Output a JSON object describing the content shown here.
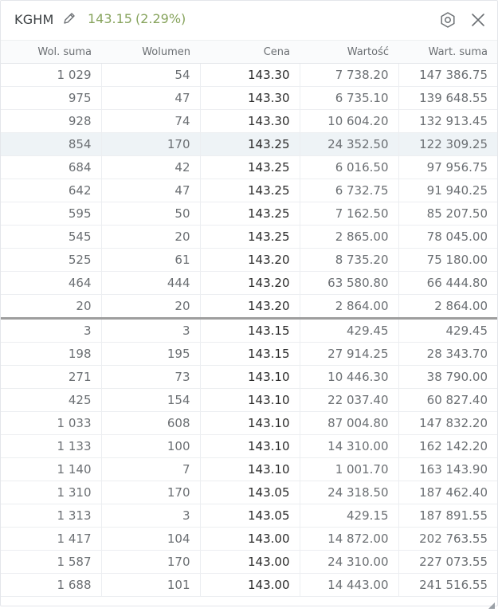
{
  "header": {
    "ticker": "KGHM",
    "last_price": "143.15",
    "change": "(2.29%)",
    "icons": {
      "edit": "pencil-icon",
      "settings": "gear-icon",
      "close": "close-icon",
      "resize": "resize-grip-icon"
    },
    "colors": {
      "price": "#86a35c"
    }
  },
  "table": {
    "columns": [
      "Wol. suma",
      "Wolumen",
      "Cena",
      "Wartość",
      "Wart. suma"
    ],
    "sell_rows": [
      [
        "1 029",
        "54",
        "143.30",
        "7 738.20",
        "147 386.75"
      ],
      [
        "975",
        "47",
        "143.30",
        "6 735.10",
        "139 648.55"
      ],
      [
        "928",
        "74",
        "143.30",
        "10 604.20",
        "132 913.45"
      ],
      [
        "854",
        "170",
        "143.25",
        "24 352.50",
        "122 309.25"
      ],
      [
        "684",
        "42",
        "143.25",
        "6 016.50",
        "97 956.75"
      ],
      [
        "642",
        "47",
        "143.25",
        "6 732.75",
        "91 940.25"
      ],
      [
        "595",
        "50",
        "143.25",
        "7 162.50",
        "85 207.50"
      ],
      [
        "545",
        "20",
        "143.25",
        "2 865.00",
        "78 045.00"
      ],
      [
        "525",
        "61",
        "143.20",
        "8 735.20",
        "75 180.00"
      ],
      [
        "464",
        "444",
        "143.20",
        "63 580.80",
        "66 444.80"
      ],
      [
        "20",
        "20",
        "143.20",
        "2 864.00",
        "2 864.00"
      ]
    ],
    "buy_rows": [
      [
        "3",
        "3",
        "143.15",
        "429.45",
        "429.45"
      ],
      [
        "198",
        "195",
        "143.15",
        "27 914.25",
        "28 343.70"
      ],
      [
        "271",
        "73",
        "143.10",
        "10 446.30",
        "38 790.00"
      ],
      [
        "425",
        "154",
        "143.10",
        "22 037.40",
        "60 827.40"
      ],
      [
        "1 033",
        "608",
        "143.10",
        "87 004.80",
        "147 832.20"
      ],
      [
        "1 133",
        "100",
        "143.10",
        "14 310.00",
        "162 142.20"
      ],
      [
        "1 140",
        "7",
        "143.10",
        "1 001.70",
        "163 143.90"
      ],
      [
        "1 310",
        "170",
        "143.05",
        "24 318.50",
        "187 462.40"
      ],
      [
        "1 313",
        "3",
        "143.05",
        "429.15",
        "187 891.55"
      ],
      [
        "1 417",
        "104",
        "143.00",
        "14 872.00",
        "202 763.55"
      ],
      [
        "1 587",
        "170",
        "143.00",
        "24 310.00",
        "227 073.55"
      ],
      [
        "1 688",
        "101",
        "143.00",
        "14 443.00",
        "241 516.55"
      ]
    ]
  }
}
